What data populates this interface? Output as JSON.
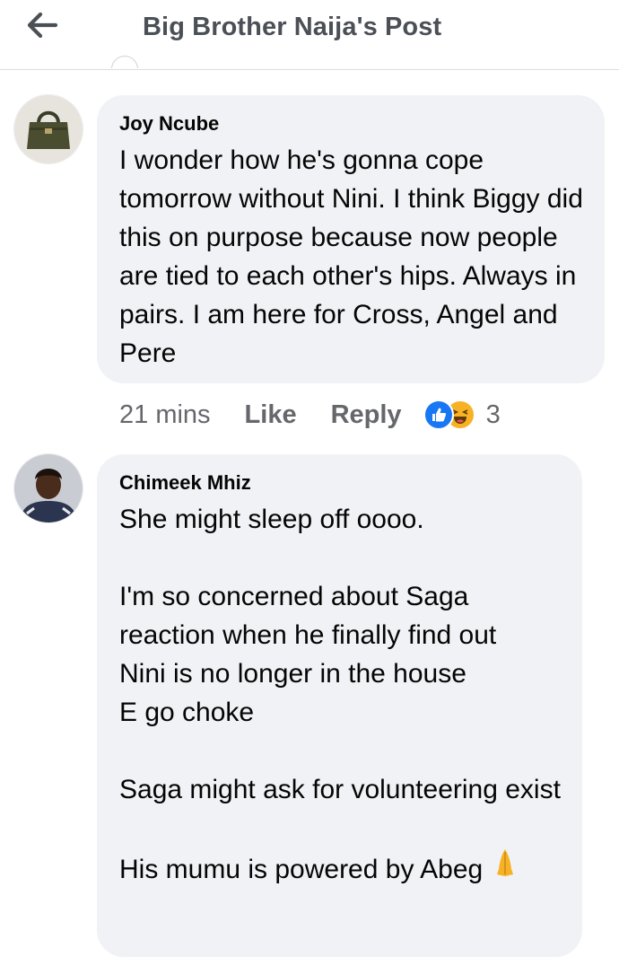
{
  "header": {
    "title": "Big Brother Naija's Post"
  },
  "comments": [
    {
      "author": "Joy Ncube",
      "text": "I wonder how he's gonna cope tomorrow without Nini. I think Biggy did this on purpose because now people are tied to each other's hips. Always in pairs. I am here for Cross, Angel and Pere",
      "time": "21 mins",
      "like_label": "Like",
      "reply_label": "Reply",
      "reaction_icons": [
        "like-reaction-icon",
        "haha-reaction-icon"
      ],
      "reaction_count": "3"
    },
    {
      "author": "Chimeek Mhiz",
      "paragraphs": [
        "She might sleep off oooo.",
        "I'm so concerned about Saga reaction when he finally find out\nNini is no longer in the house\nE go choke",
        "Saga might ask for volunteering exist",
        "His mumu is powered by Abeg"
      ],
      "trailing_emoji_icon": "folded-hands-icon"
    }
  ],
  "colors": {
    "bubble": "#f0f2f5",
    "header_text": "#4b4f56",
    "meta_text": "#65676b",
    "like_blue": "#1877f2",
    "haha_yellow": "#f7b125"
  }
}
